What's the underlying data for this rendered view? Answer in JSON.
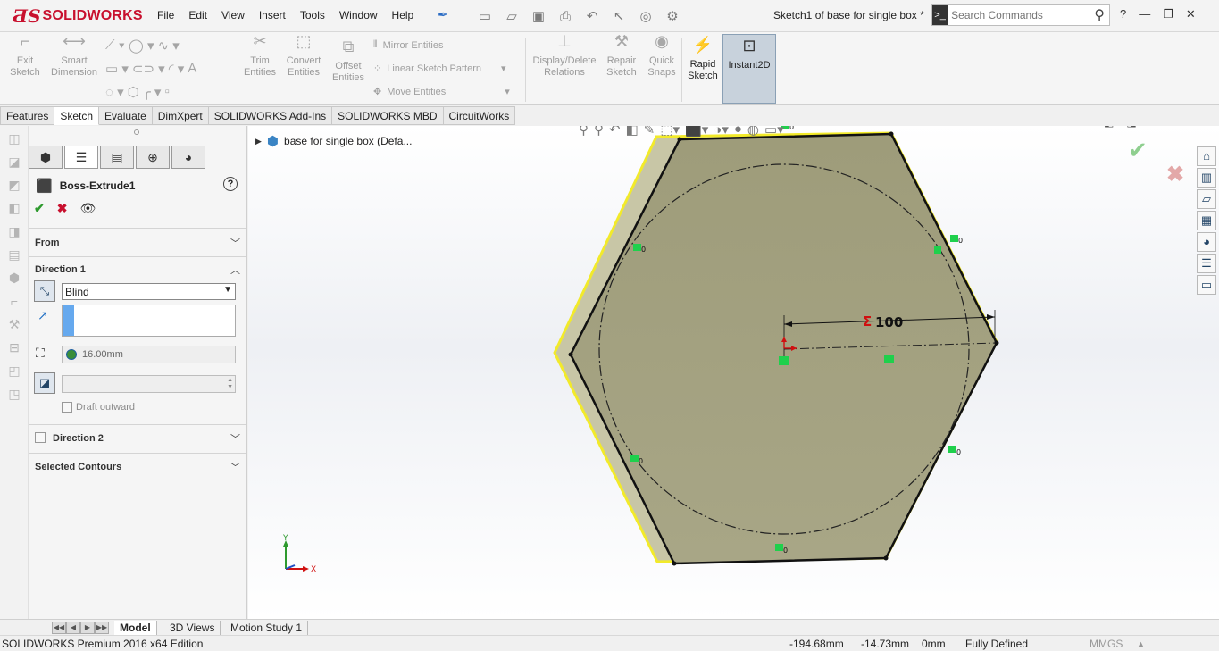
{
  "app": {
    "brand": "SOLIDWORKS",
    "document_title": "Sketch1 of base for single box *"
  },
  "menu": [
    "File",
    "Edit",
    "View",
    "Insert",
    "Tools",
    "Window",
    "Help"
  ],
  "search": {
    "placeholder": "Search Commands"
  },
  "commands": {
    "exit_sketch": "Exit\nSketch",
    "smart_dimension": "Smart\nDimension",
    "trim_entities": "Trim\nEntities",
    "convert_entities": "Convert\nEntities",
    "offset_entities": "Offset\nEntities",
    "mirror_entities": "Mirror Entities",
    "linear_sketch_pattern": "Linear Sketch Pattern",
    "move_entities": "Move Entities",
    "display_delete_relations": "Display/Delete\nRelations",
    "repair_sketch": "Repair\nSketch",
    "quick_snaps": "Quick\nSnaps",
    "rapid_sketch": "Rapid\nSketch",
    "instant2d": "Instant2D"
  },
  "tabs": [
    "Features",
    "Sketch",
    "Evaluate",
    "DimXpert",
    "SOLIDWORKS Add-Ins",
    "SOLIDWORKS MBD",
    "CircuitWorks"
  ],
  "active_tab": "Sketch",
  "property_manager": {
    "title": "Boss-Extrude1",
    "help": "?",
    "sections": {
      "from": "From",
      "direction1": "Direction 1",
      "direction2": "Direction 2",
      "selected_contours": "Selected Contours"
    },
    "end_condition": "Blind",
    "depth": "16.00mm",
    "draft_outward": "Draft outward"
  },
  "feature_tree": {
    "part_label": "base for single box  (Defa..."
  },
  "sketch": {
    "dimension_label": "100",
    "relation_mark": "0",
    "triad_y": "Y",
    "triad_x": "X"
  },
  "bottom_tabs": [
    "Model",
    "3D Views",
    "Motion Study 1"
  ],
  "status_bar": {
    "edition": "SOLIDWORKS Premium 2016 x64 Edition",
    "x": "-194.68mm",
    "y": "-14.73mm",
    "z": "0mm",
    "state": "Fully Defined",
    "units": "MMGS",
    "units_arrow": "▲"
  },
  "colors": {
    "brand_red": "#c8102e",
    "face_fill": "#9c9a78",
    "edge_yellow": "#f2ea2a",
    "relation_green": "#1fd04c",
    "instant2d_active": "#c8d2dc"
  }
}
